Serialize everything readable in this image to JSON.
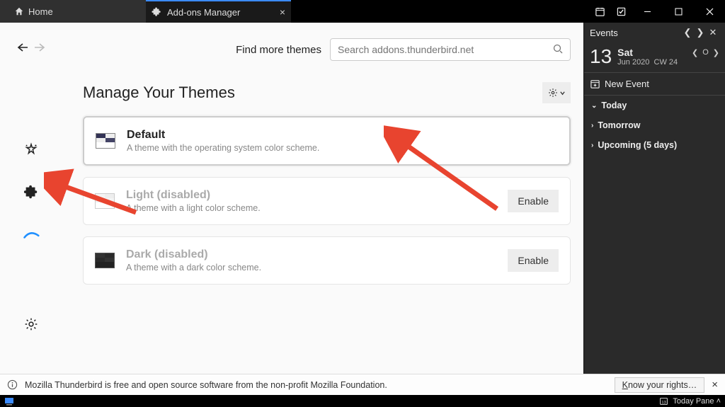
{
  "window": {
    "tabs": {
      "home": "Home",
      "addons": "Add-ons Manager"
    }
  },
  "addons": {
    "search_label": "Find more themes",
    "search_placeholder": "Search addons.thunderbird.net",
    "section_title": "Manage Your Themes"
  },
  "themes": [
    {
      "name": "Default",
      "desc": "A theme with the operating system color scheme.",
      "state": "active"
    },
    {
      "name": "Light (disabled)",
      "desc": "A theme with a light color scheme.",
      "state": "disabled",
      "action": "Enable"
    },
    {
      "name": "Dark (disabled)",
      "desc": "A theme with a dark color scheme.",
      "state": "disabled",
      "action": "Enable"
    }
  ],
  "events": {
    "title": "Events",
    "day_number": "13",
    "day_name": "Sat",
    "month_year": "Jun 2020",
    "cw": "CW 24",
    "new_event": "New Event",
    "sections": {
      "today": "Today",
      "tomorrow": "Tomorrow",
      "upcoming": "Upcoming (5 days)"
    }
  },
  "status": {
    "message": "Mozilla Thunderbird is free and open source software from the non-profit Mozilla Foundation.",
    "rights": "Know your rights…"
  },
  "taskbar": {
    "today_pane": "Today Pane"
  }
}
